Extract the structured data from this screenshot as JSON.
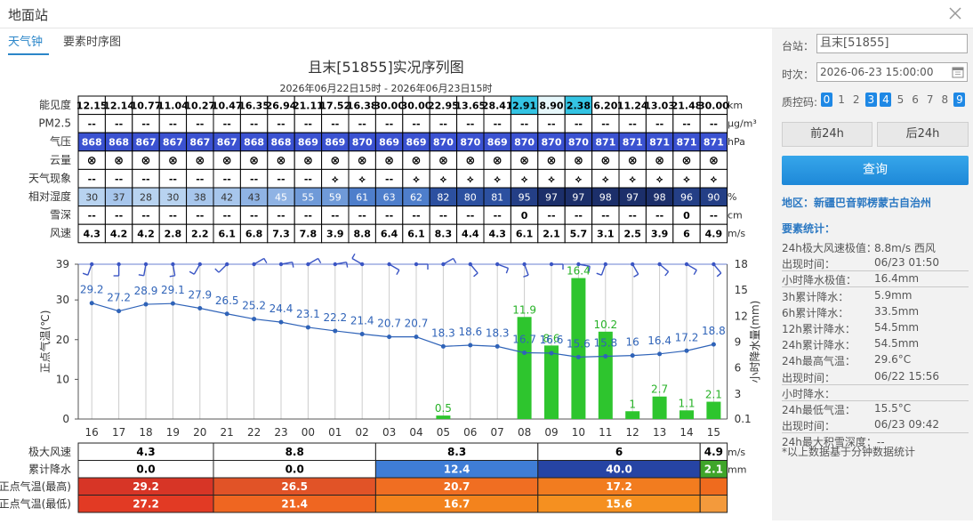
{
  "window": {
    "title": "地面站"
  },
  "tabs": [
    {
      "label": "天气钟"
    },
    {
      "label": "要素时序图"
    }
  ],
  "chart": {
    "title": "且末[51855]实况序列图",
    "subtitle": "2026年06月22日15时 - 2026年06月23日15时",
    "rows": [
      {
        "label": "能见度",
        "unit": "km",
        "cells": [
          "12.15",
          "12.14",
          "10.77",
          "11.04",
          "10.27",
          "10.47",
          "16.35",
          "26.94",
          "21.11",
          "17.52",
          "16.38",
          "30.00",
          "30.00",
          "22.95",
          "13.65",
          "28.41",
          "2.91",
          "8.90",
          "2.38",
          "6.20",
          "11.24",
          "13.03",
          "21.48",
          "30.00"
        ]
      },
      {
        "label": "PM2.5",
        "unit": "μg/m³",
        "cells": [
          "--",
          "--",
          "--",
          "--",
          "--",
          "--",
          "--",
          "--",
          "--",
          "--",
          "--",
          "--",
          "--",
          "--",
          "--",
          "--",
          "--",
          "--",
          "--",
          "--",
          "--",
          "--",
          "--",
          "--"
        ]
      },
      {
        "label": "气压",
        "unit": "hPa",
        "cells": [
          "868",
          "868",
          "867",
          "867",
          "867",
          "867",
          "868",
          "868",
          "869",
          "869",
          "870",
          "869",
          "869",
          "870",
          "870",
          "869",
          "870",
          "870",
          "870",
          "871",
          "871",
          "871",
          "871",
          "871"
        ]
      },
      {
        "label": "云量",
        "unit": "",
        "cells": [
          "⊗",
          "⊗",
          "⊗",
          "⊗",
          "⊗",
          "⊗",
          "⊗",
          "⊗",
          "⊗",
          "⊗",
          "⊗",
          "⊗",
          "⊗",
          "⊗",
          "⊗",
          "⊗",
          "⊗",
          "⊗",
          "⊗",
          "⊗",
          "⊗",
          "⊗",
          "⊗",
          "⊗"
        ]
      },
      {
        "label": "天气现象",
        "unit": "",
        "cells": [
          "--",
          "--",
          "--",
          "--",
          "--",
          "--",
          "--",
          "--",
          "--",
          "⟡",
          "⟡",
          "--",
          "⟡",
          "⟡",
          "⟡",
          "⟡",
          "⟡",
          "⟡",
          "⟡",
          "⟡",
          "⟡",
          "⟡",
          "⟡",
          "⟡"
        ]
      },
      {
        "label": "相对湿度",
        "unit": "%",
        "cells": [
          "30",
          "37",
          "28",
          "30",
          "38",
          "42",
          "43",
          "45",
          "55",
          "59",
          "61",
          "63",
          "62",
          "82",
          "80",
          "81",
          "95",
          "97",
          "97",
          "98",
          "97",
          "98",
          "96",
          "90"
        ]
      },
      {
        "label": "雪深",
        "unit": "cm",
        "cells": [
          "--",
          "--",
          "--",
          "--",
          "--",
          "--",
          "--",
          "--",
          "--",
          "--",
          "--",
          "--",
          "--",
          "--",
          "--",
          "--",
          "0",
          "--",
          "--",
          "--",
          "--",
          "--",
          "0",
          "--"
        ]
      },
      {
        "label": "风速",
        "unit": "m/s",
        "cells": [
          "4.3",
          "4.2",
          "4.2",
          "2.8",
          "2.2",
          "6.1",
          "6.8",
          "7.3",
          "7.8",
          "3.9",
          "8.8",
          "6.4",
          "6.1",
          "8.3",
          "4.4",
          "4.3",
          "6.1",
          "2.1",
          "5.7",
          "3.1",
          "2.5",
          "3.9",
          "6",
          "4.9"
        ]
      }
    ],
    "vis_highlight": {
      "16": "#34c4e3",
      "18": "#34c4e3",
      "17": "#e6f7fb"
    },
    "colors": {
      "pressure": "#3b52d1",
      "humidity": [
        "#b8d3f0",
        "#a7c6ec",
        "#8fb3e4",
        "#6f9ad8",
        "#4e7ecb",
        "#3a67b8",
        "#2c50a0",
        "#243f86",
        "#1c2f6a"
      ]
    }
  },
  "chart_data": {
    "type": "line",
    "x": [
      "16",
      "17",
      "18",
      "19",
      "20",
      "21",
      "22",
      "23",
      "00",
      "01",
      "02",
      "03",
      "04",
      "05",
      "06",
      "07",
      "08",
      "09",
      "10",
      "11",
      "12",
      "13",
      "14",
      "15"
    ],
    "series": [
      {
        "values": [
          29.2,
          27.2,
          28.9,
          29.1,
          27.9,
          26.5,
          25.2,
          24.4,
          23.1,
          22.2,
          21.4,
          20.7,
          20.7,
          18.3,
          18.6,
          18.3,
          16.7,
          16.6,
          15.6,
          15.8,
          16,
          16.4,
          17.2,
          18.8
        ]
      },
      {
        "values": [
          null,
          null,
          null,
          null,
          null,
          null,
          null,
          null,
          null,
          null,
          null,
          null,
          null,
          0.5,
          null,
          null,
          11.9,
          8.6,
          16.4,
          10.2,
          1,
          2.7,
          1.1,
          2.1
        ]
      }
    ],
    "ylabel": "正点气温(℃)",
    "y2label": "小时降水量(mm)",
    "ylim": [
      0,
      39
    ],
    "y2lim": [
      0.1,
      18
    ],
    "yticks": [
      "0",
      "10",
      "20",
      "30",
      "39"
    ],
    "y2ticks": [
      "0.1",
      "3",
      "6",
      "9",
      "12",
      "15",
      "18"
    ]
  },
  "summary": {
    "rows": [
      {
        "label": "极大风速",
        "unit": "m/s",
        "values": [
          "4.3",
          "8.8",
          "8.3",
          "6",
          "4.9"
        ]
      },
      {
        "label": "累计降水",
        "unit": "mm",
        "values": [
          "0.0",
          "0.0",
          "12.4",
          "40.0",
          "2.1"
        ]
      },
      {
        "label": "正点气温(最高)",
        "unit": "",
        "values": [
          "29.2",
          "26.5",
          "20.7",
          "17.2",
          ""
        ]
      },
      {
        "label": "正点气温(最低)",
        "unit": "",
        "values": [
          "27.2",
          "21.4",
          "16.7",
          "15.6",
          ""
        ]
      }
    ]
  },
  "side": {
    "station_label": "台站：",
    "station_value": "且末[51855]",
    "time_label": "时次：",
    "time_value": "2026-06-23 15:00:00",
    "qc_label": "质控码:",
    "qc_codes": [
      {
        "v": "0",
        "on": true
      },
      {
        "v": "1",
        "on": false
      },
      {
        "v": "2",
        "on": false
      },
      {
        "v": "3",
        "on": true
      },
      {
        "v": "4",
        "on": true
      },
      {
        "v": "5",
        "on": false
      },
      {
        "v": "6",
        "on": false
      },
      {
        "v": "7",
        "on": false
      },
      {
        "v": "8",
        "on": false
      },
      {
        "v": "9",
        "on": true
      }
    ],
    "prev_button": "前24h",
    "next_button": "后24h",
    "query_button": "查询",
    "region": "地区：新疆巴音郭楞蒙古自治州",
    "stats_title": "要素统计：",
    "stats": [
      {
        "label": "24h极大风速极值：",
        "value": "8.8m/s 西风"
      },
      {
        "label": "出现时间：",
        "value": "06/23 01:50"
      },
      {
        "label": "小时降水极值：",
        "value": "16.4mm"
      },
      {
        "label": "3h累计降水：",
        "value": "5.9mm"
      },
      {
        "label": "6h累计降水：",
        "value": "33.5mm"
      },
      {
        "label": "12h累计降水：",
        "value": "54.5mm"
      },
      {
        "label": "24h累计降水：",
        "value": "54.5mm"
      },
      {
        "label": "24h最高气温：",
        "value": "29.6°C"
      },
      {
        "label": "出现时间：",
        "value": "06/22 15:56"
      },
      {
        "label": "小时降水：",
        "value": ""
      },
      {
        "label": "24h最低气温：",
        "value": "15.5°C"
      },
      {
        "label": "出现时间：",
        "value": "06/23 09:42"
      },
      {
        "label": "24h最大积雪深度：--",
        "value": ""
      }
    ],
    "note": "*以上数据基于分钟数据统计"
  }
}
